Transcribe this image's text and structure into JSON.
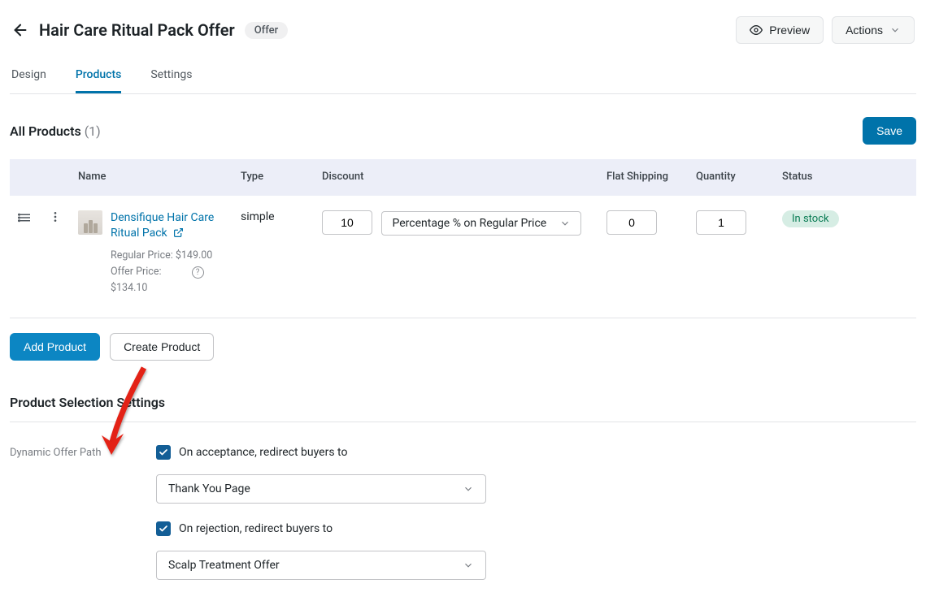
{
  "header": {
    "title": "Hair Care Ritual Pack Offer",
    "badge": "Offer",
    "preview": "Preview",
    "actions": "Actions"
  },
  "tabs": {
    "design": "Design",
    "products": "Products",
    "settings": "Settings"
  },
  "section": {
    "title": "All Products",
    "count": "(1)",
    "save": "Save"
  },
  "table": {
    "cols": {
      "name": "Name",
      "type": "Type",
      "discount": "Discount",
      "flat_shipping": "Flat Shipping",
      "quantity": "Quantity",
      "status": "Status"
    },
    "row": {
      "product_name": "Densifique Hair Care Ritual Pack",
      "regular_price": "Regular Price: $149.00",
      "offer_price_label": "Offer Price:",
      "offer_price_value": "$134.10",
      "type": "simple",
      "discount_value": "10",
      "discount_type": "Percentage % on Regular Price",
      "flat_shipping": "0",
      "quantity": "1",
      "status": "In stock"
    }
  },
  "actions": {
    "add_product": "Add Product",
    "create_product": "Create Product"
  },
  "selection_settings": {
    "heading": "Product Selection Settings",
    "label": "Dynamic Offer Path",
    "accept_text": "On acceptance, redirect buyers to",
    "accept_target": "Thank You Page",
    "reject_text": "On rejection, redirect buyers to",
    "reject_target": "Scalp Treatment Offer"
  }
}
